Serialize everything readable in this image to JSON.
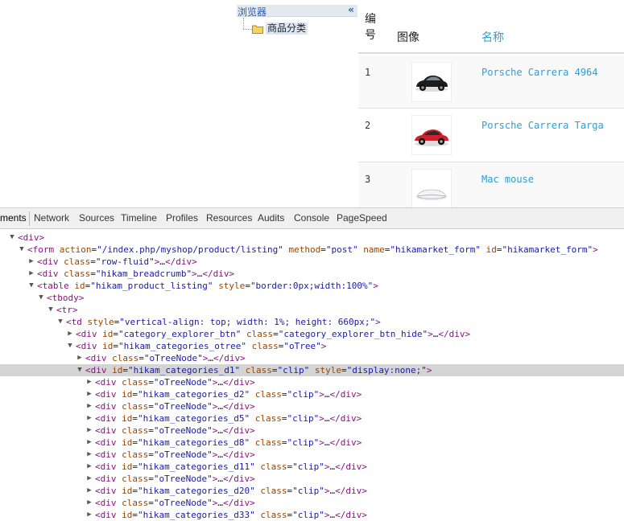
{
  "explorer": {
    "title": "浏览器",
    "collapse_glyph": "«",
    "tree_item": "商品分类"
  },
  "product_table": {
    "headers": {
      "number": "编号",
      "image": "图像",
      "name": "名称"
    },
    "rows": [
      {
        "number": "1",
        "name": "Porsche Carrera 4964",
        "image": "black-car-image"
      },
      {
        "number": "2",
        "name": "Porsche Carrera Targa",
        "image": "red-car-image"
      },
      {
        "number": "3",
        "name": "Mac mouse",
        "image": "mouse-image"
      }
    ]
  },
  "devtools": {
    "tabs": [
      "ments",
      "Network",
      "Sources",
      "Timeline",
      "Profiles",
      "Resources",
      "Audits",
      "Console",
      "PageSpeed"
    ],
    "active_tab": "ments",
    "lines": [
      {
        "tri": "▼",
        "code": [
          [
            "tg",
            "<div>"
          ]
        ]
      },
      {
        "tri": "▼",
        "code": [
          [
            "tg",
            "<form "
          ],
          [
            "an",
            "action"
          ],
          [
            "pl",
            "="
          ],
          [
            "av",
            "\"/index.php/myshop/product/listing\""
          ],
          [
            "pl",
            " "
          ],
          [
            "an",
            "method"
          ],
          [
            "pl",
            "="
          ],
          [
            "av",
            "\"post\""
          ],
          [
            "pl",
            " "
          ],
          [
            "an",
            "name"
          ],
          [
            "pl",
            "="
          ],
          [
            "av",
            "\"hikamarket_form\""
          ],
          [
            "pl",
            " "
          ],
          [
            "an",
            "id"
          ],
          [
            "pl",
            "="
          ],
          [
            "av",
            "\"hikamarket_form\""
          ],
          [
            "tg",
            ">"
          ]
        ]
      },
      {
        "tri": "▶",
        "code": [
          [
            "tg",
            "<div "
          ],
          [
            "an",
            "class"
          ],
          [
            "pl",
            "="
          ],
          [
            "av",
            "\"row-fluid\""
          ],
          [
            "tg",
            ">"
          ],
          [
            "pl",
            "…"
          ],
          [
            "tg",
            "</div>"
          ]
        ]
      },
      {
        "tri": "▶",
        "code": [
          [
            "tg",
            "<div "
          ],
          [
            "an",
            "class"
          ],
          [
            "pl",
            "="
          ],
          [
            "av",
            "\"hikam_breadcrumb\""
          ],
          [
            "tg",
            ">"
          ],
          [
            "pl",
            "…"
          ],
          [
            "tg",
            "</div>"
          ]
        ]
      },
      {
        "tri": "▼",
        "code": [
          [
            "tg",
            "<table "
          ],
          [
            "an",
            "id"
          ],
          [
            "pl",
            "="
          ],
          [
            "av",
            "\"hikam_product_listing\""
          ],
          [
            "pl",
            " "
          ],
          [
            "an",
            "style"
          ],
          [
            "pl",
            "="
          ],
          [
            "av",
            "\"border:0px;width:100%\""
          ],
          [
            "tg",
            ">"
          ]
        ]
      },
      {
        "tri": "▼",
        "code": [
          [
            "tg",
            "<tbody>"
          ]
        ]
      },
      {
        "tri": "▼",
        "code": [
          [
            "tg",
            "<tr>"
          ]
        ]
      },
      {
        "tri": "▼",
        "code": [
          [
            "tg",
            "<td "
          ],
          [
            "an",
            "style"
          ],
          [
            "pl",
            "="
          ],
          [
            "av",
            "\"vertical-align: top; width: 1%; height: 660px;\""
          ],
          [
            "tg",
            ">"
          ]
        ]
      },
      {
        "tri": "▶",
        "code": [
          [
            "tg",
            "<div "
          ],
          [
            "an",
            "id"
          ],
          [
            "pl",
            "="
          ],
          [
            "av",
            "\"category_explorer_btn\""
          ],
          [
            "pl",
            " "
          ],
          [
            "an",
            "class"
          ],
          [
            "pl",
            "="
          ],
          [
            "av",
            "\"category_explorer_btn_hide\""
          ],
          [
            "tg",
            ">"
          ],
          [
            "pl",
            "…"
          ],
          [
            "tg",
            "</div>"
          ]
        ]
      },
      {
        "tri": "▼",
        "code": [
          [
            "tg",
            "<div "
          ],
          [
            "an",
            "id"
          ],
          [
            "pl",
            "="
          ],
          [
            "av",
            "\"hikam_categories_otree\""
          ],
          [
            "pl",
            " "
          ],
          [
            "an",
            "class"
          ],
          [
            "pl",
            "="
          ],
          [
            "av",
            "\"oTree\""
          ],
          [
            "tg",
            ">"
          ]
        ]
      },
      {
        "tri": "▶",
        "code": [
          [
            "tg",
            "<div "
          ],
          [
            "an",
            "class"
          ],
          [
            "pl",
            "="
          ],
          [
            "av",
            "\"oTreeNode\""
          ],
          [
            "tg",
            ">"
          ],
          [
            "pl",
            "…"
          ],
          [
            "tg",
            "</div>"
          ]
        ]
      },
      {
        "tri": "▼",
        "code": [
          [
            "tg",
            "<div "
          ],
          [
            "an",
            "id"
          ],
          [
            "pl",
            "="
          ],
          [
            "av",
            "\"hikam_categories_d1\""
          ],
          [
            "pl",
            " "
          ],
          [
            "an",
            "class"
          ],
          [
            "pl",
            "="
          ],
          [
            "av",
            "\"clip\""
          ],
          [
            "pl",
            " "
          ],
          [
            "an",
            "style"
          ],
          [
            "pl",
            "="
          ],
          [
            "av",
            "\"display:none;\""
          ],
          [
            "tg",
            ">"
          ]
        ]
      },
      {
        "tri": "▶",
        "code": [
          [
            "tg",
            "<div "
          ],
          [
            "an",
            "class"
          ],
          [
            "pl",
            "="
          ],
          [
            "av",
            "\"oTreeNode\""
          ],
          [
            "tg",
            ">"
          ],
          [
            "pl",
            "…"
          ],
          [
            "tg",
            "</div>"
          ]
        ]
      },
      {
        "tri": "▶",
        "code": [
          [
            "tg",
            "<div "
          ],
          [
            "an",
            "id"
          ],
          [
            "pl",
            "="
          ],
          [
            "av",
            "\"hikam_categories_d2\""
          ],
          [
            "pl",
            " "
          ],
          [
            "an",
            "class"
          ],
          [
            "pl",
            "="
          ],
          [
            "av",
            "\"clip\""
          ],
          [
            "tg",
            ">"
          ],
          [
            "pl",
            "…"
          ],
          [
            "tg",
            "</div>"
          ]
        ]
      },
      {
        "tri": "▶",
        "code": [
          [
            "tg",
            "<div "
          ],
          [
            "an",
            "class"
          ],
          [
            "pl",
            "="
          ],
          [
            "av",
            "\"oTreeNode\""
          ],
          [
            "tg",
            ">"
          ],
          [
            "pl",
            "…"
          ],
          [
            "tg",
            "</div>"
          ]
        ]
      },
      {
        "tri": "▶",
        "code": [
          [
            "tg",
            "<div "
          ],
          [
            "an",
            "id"
          ],
          [
            "pl",
            "="
          ],
          [
            "av",
            "\"hikam_categories_d5\""
          ],
          [
            "pl",
            " "
          ],
          [
            "an",
            "class"
          ],
          [
            "pl",
            "="
          ],
          [
            "av",
            "\"clip\""
          ],
          [
            "tg",
            ">"
          ],
          [
            "pl",
            "…"
          ],
          [
            "tg",
            "</div>"
          ]
        ]
      },
      {
        "tri": "▶",
        "code": [
          [
            "tg",
            "<div "
          ],
          [
            "an",
            "class"
          ],
          [
            "pl",
            "="
          ],
          [
            "av",
            "\"oTreeNode\""
          ],
          [
            "tg",
            ">"
          ],
          [
            "pl",
            "…"
          ],
          [
            "tg",
            "</div>"
          ]
        ]
      },
      {
        "tri": "▶",
        "code": [
          [
            "tg",
            "<div "
          ],
          [
            "an",
            "id"
          ],
          [
            "pl",
            "="
          ],
          [
            "av",
            "\"hikam_categories_d8\""
          ],
          [
            "pl",
            " "
          ],
          [
            "an",
            "class"
          ],
          [
            "pl",
            "="
          ],
          [
            "av",
            "\"clip\""
          ],
          [
            "tg",
            ">"
          ],
          [
            "pl",
            "…"
          ],
          [
            "tg",
            "</div>"
          ]
        ]
      },
      {
        "tri": "▶",
        "code": [
          [
            "tg",
            "<div "
          ],
          [
            "an",
            "class"
          ],
          [
            "pl",
            "="
          ],
          [
            "av",
            "\"oTreeNode\""
          ],
          [
            "tg",
            ">"
          ],
          [
            "pl",
            "…"
          ],
          [
            "tg",
            "</div>"
          ]
        ]
      },
      {
        "tri": "▶",
        "code": [
          [
            "tg",
            "<div "
          ],
          [
            "an",
            "id"
          ],
          [
            "pl",
            "="
          ],
          [
            "av",
            "\"hikam_categories_d11\""
          ],
          [
            "pl",
            " "
          ],
          [
            "an",
            "class"
          ],
          [
            "pl",
            "="
          ],
          [
            "av",
            "\"clip\""
          ],
          [
            "tg",
            ">"
          ],
          [
            "pl",
            "…"
          ],
          [
            "tg",
            "</div>"
          ]
        ]
      },
      {
        "tri": "▶",
        "code": [
          [
            "tg",
            "<div "
          ],
          [
            "an",
            "class"
          ],
          [
            "pl",
            "="
          ],
          [
            "av",
            "\"oTreeNode\""
          ],
          [
            "tg",
            ">"
          ],
          [
            "pl",
            "…"
          ],
          [
            "tg",
            "</div>"
          ]
        ]
      },
      {
        "tri": "▶",
        "code": [
          [
            "tg",
            "<div "
          ],
          [
            "an",
            "id"
          ],
          [
            "pl",
            "="
          ],
          [
            "av",
            "\"hikam_categories_d20\""
          ],
          [
            "pl",
            " "
          ],
          [
            "an",
            "class"
          ],
          [
            "pl",
            "="
          ],
          [
            "av",
            "\"clip\""
          ],
          [
            "tg",
            ">"
          ],
          [
            "pl",
            "…"
          ],
          [
            "tg",
            "</div>"
          ]
        ]
      },
      {
        "tri": "▶",
        "code": [
          [
            "tg",
            "<div "
          ],
          [
            "an",
            "class"
          ],
          [
            "pl",
            "="
          ],
          [
            "av",
            "\"oTreeNode\""
          ],
          [
            "tg",
            ">"
          ],
          [
            "pl",
            "…"
          ],
          [
            "tg",
            "</div>"
          ]
        ]
      },
      {
        "tri": "▶",
        "code": [
          [
            "tg",
            "<div "
          ],
          [
            "an",
            "id"
          ],
          [
            "pl",
            "="
          ],
          [
            "av",
            "\"hikam_categories_d33\""
          ],
          [
            "pl",
            " "
          ],
          [
            "an",
            "class"
          ],
          [
            "pl",
            "="
          ],
          [
            "av",
            "\"clip\""
          ],
          [
            "tg",
            ">"
          ],
          [
            "pl",
            "…"
          ],
          [
            "tg",
            "</div>"
          ]
        ]
      }
    ]
  }
}
